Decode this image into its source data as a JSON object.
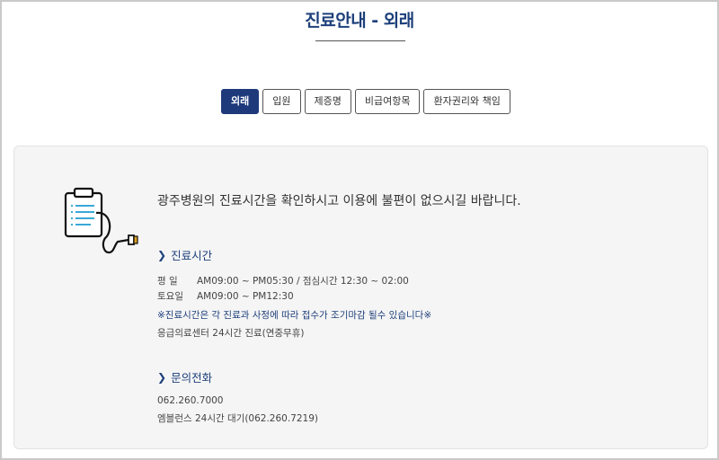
{
  "page": {
    "title": "진료안내 - 외래"
  },
  "tabs": [
    {
      "label": "외래",
      "active": true
    },
    {
      "label": "입원",
      "active": false
    },
    {
      "label": "제증명",
      "active": false
    },
    {
      "label": "비급여항목",
      "active": false
    },
    {
      "label": "환자권리와 책임",
      "active": false
    }
  ],
  "panel": {
    "icon": "clipboard-stethoscope-icon",
    "headline": "광주병원의 진료시간을 확인하시고 이용에 불편이 없으시길 바랍니다.",
    "hours": {
      "heading": "진료시간",
      "weekday_label": "평 일",
      "weekday_value": "AM09:00 ~ PM05:30 / 점심시간 12:30 ~ 02:00",
      "saturday_label": "토요일",
      "saturday_value": "AM09:00 ~ PM12:30",
      "notice": "※진료시간은 각 진료과 사정에 따라 접수가 조기마감 될수 있습니다※",
      "emergency": "응급의료센터 24시간 진료(연중무휴)"
    },
    "contact": {
      "heading": "문의전화",
      "phone": "062.260.7000",
      "ambulance": "엠블런스 24시간 대기(062.260.7219)"
    }
  },
  "colors": {
    "accent": "#1e3a7b",
    "title": "#1d3f7a",
    "panel_bg": "#f5f5f5",
    "icon_stroke": "#111111",
    "icon_lines": "#3aa8d8",
    "icon_tip": "#e0a020"
  }
}
